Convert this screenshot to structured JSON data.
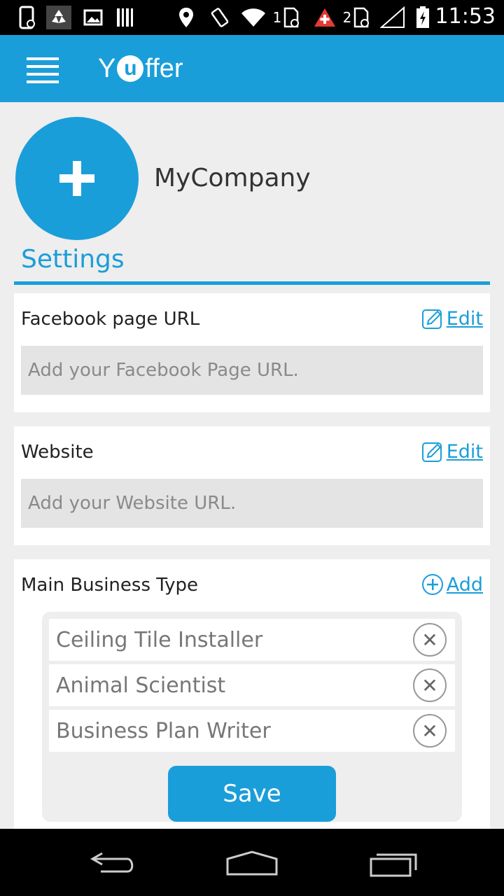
{
  "status_bar": {
    "time": "11:53",
    "sim1_label": "1",
    "sim2_label": "2",
    "icons": [
      "phone-icon",
      "recycle-icon",
      "image-icon",
      "barcode-icon",
      "location-icon",
      "rotate-icon",
      "wifi-icon",
      "sim-icon",
      "alert-icon",
      "sim-icon",
      "signal-icon",
      "battery-icon"
    ]
  },
  "app_bar": {
    "logo_left": "Y",
    "logo_mid": "u",
    "logo_right": "ffer"
  },
  "profile": {
    "company_name": "MyCompany"
  },
  "settings": {
    "title": "Settings",
    "facebook": {
      "label": "Facebook page URL",
      "action": "Edit",
      "placeholder": "Add your Facebook Page URL."
    },
    "website": {
      "label": "Website",
      "action": "Edit",
      "placeholder": "Add your Website URL."
    },
    "business_type": {
      "label": "Main Business Type",
      "action": "Add",
      "items": [
        "Ceiling Tile Installer",
        "Animal Scientist",
        "Business Plan Writer"
      ]
    }
  },
  "save_label": "Save",
  "colors": {
    "accent": "#1a9ed9",
    "background": "#eeeeee",
    "input_bg": "#e4e4e4"
  }
}
